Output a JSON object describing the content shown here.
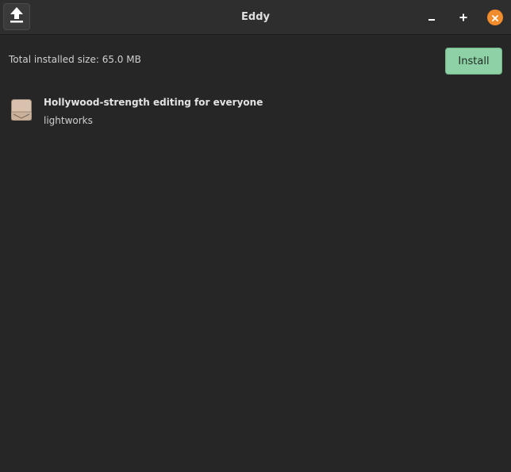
{
  "window": {
    "title": "Eddy"
  },
  "header": {
    "upload_icon": "upload-icon",
    "minimize_icon": "minimize-icon",
    "maximize_icon": "maximize-icon",
    "close_icon": "close-icon"
  },
  "main": {
    "summary": "Total installed size: 65.0 MB",
    "install_label": "Install",
    "packages": [
      {
        "icon": "package-icon",
        "description": "Hollywood-strength editing for everyone",
        "name": "lightworks"
      }
    ]
  },
  "colors": {
    "background": "#262626",
    "titlebar": "#2e2e2e",
    "install_accent": "#8fd1a6",
    "close_button": "#f08c2c"
  }
}
